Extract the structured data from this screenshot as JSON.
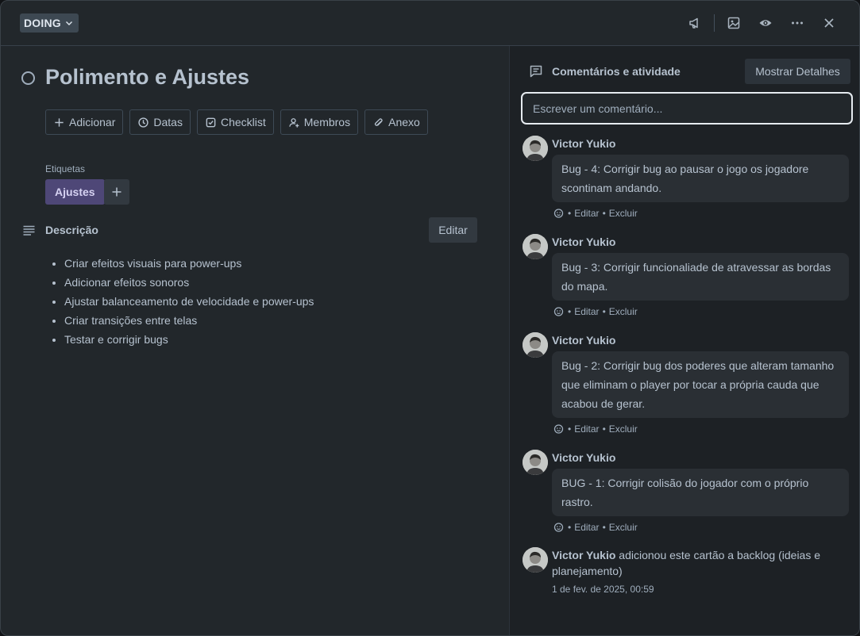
{
  "header": {
    "status_label": "DOING",
    "icons": [
      "megaphone-icon",
      "image-icon",
      "eye-icon",
      "more-icon",
      "close-icon"
    ]
  },
  "card": {
    "title": "Polimento e Ajustes",
    "actions": [
      {
        "label": "Adicionar",
        "icon": "plus-icon"
      },
      {
        "label": "Datas",
        "icon": "clock-icon"
      },
      {
        "label": "Checklist",
        "icon": "checkbox-icon"
      },
      {
        "label": "Membros",
        "icon": "add-member-icon"
      },
      {
        "label": "Anexo",
        "icon": "paperclip-icon"
      }
    ],
    "labels_title": "Etiquetas",
    "label": "Ajustes",
    "label_color": "#4e4777",
    "description_title": "Descrição",
    "edit_label": "Editar",
    "description_items": [
      "Criar efeitos visuais para power-ups",
      "Adicionar efeitos sonoros",
      "Ajustar balanceamento de velocidade e power-ups",
      "Criar transições entre telas",
      "Testar e corrigir bugs"
    ]
  },
  "activity": {
    "title": "Comentários e atividade",
    "show_details_label": "Mostrar Detalhes",
    "comment_placeholder": "Escrever um comentário...",
    "comments": [
      {
        "author": "Victor Yukio",
        "text": "Bug - 4: Corrigir bug ao pausar o jogo os jogadore scontinam andando.",
        "edit": "Editar",
        "delete": "Excluir"
      },
      {
        "author": "Victor Yukio",
        "text": "Bug - 3: Corrigir funcionaliade de atravessar as bordas do mapa.",
        "edit": "Editar",
        "delete": "Excluir"
      },
      {
        "author": "Victor Yukio",
        "text": "Bug - 2: Corrigir bug dos poderes que alteram tamanho que eliminam o player por tocar a própria cauda que acabou de gerar.",
        "edit": "Editar",
        "delete": "Excluir"
      },
      {
        "author": "Victor Yukio",
        "text": "BUG - 1: Corrigir colisão do jogador com o próprio rastro.",
        "edit": "Editar",
        "delete": "Excluir"
      }
    ],
    "event": {
      "author": "Victor Yukio",
      "action": "adicionou este cartão a backlog (ideias e planejamento)",
      "time": "1 de fev. de 2025, 00:59"
    }
  }
}
